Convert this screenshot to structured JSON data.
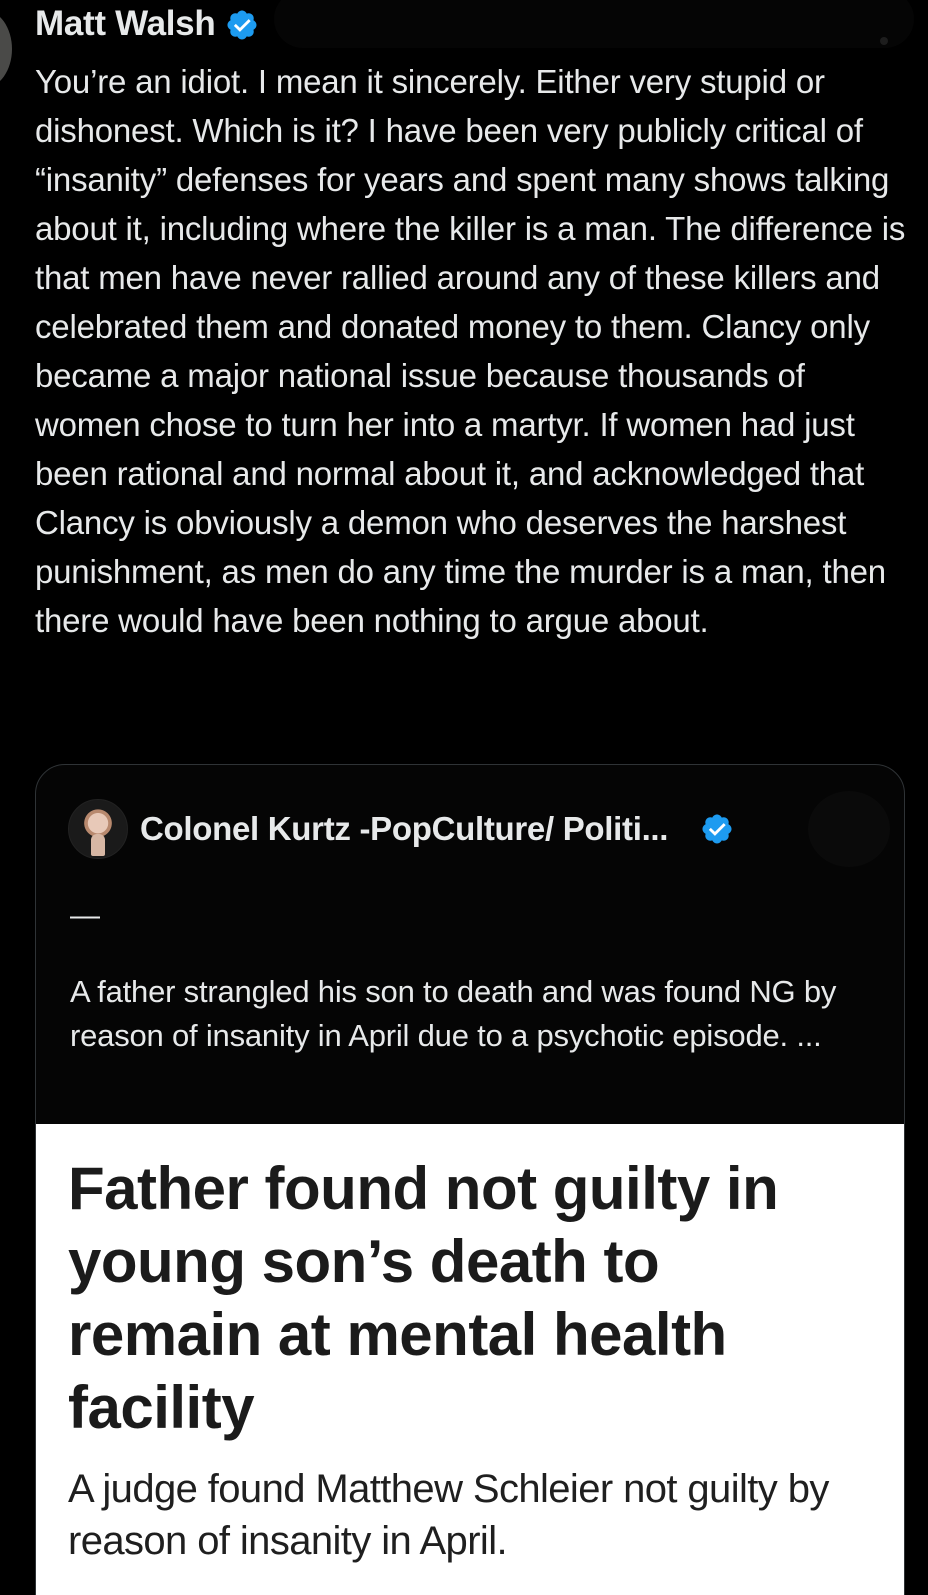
{
  "tweet": {
    "author_name": "Matt Walsh",
    "text": "You’re an idiot. I mean it sincerely. Either very stupid or dishonest. Which is it? I have been very publicly critical of “insanity” defenses for years and spent many shows talking about it, including where the killer is a man. The difference is that men have never rallied around any of these killers and celebrated them and donated money to them. Clancy only became a major national issue because thousands of women chose to turn her into a martyr. If women had just been rational and normal about it, and acknowledged that Clancy is obviously a demon who deserves the harshest punishment, as men do any time the murder is a man, then there would have been nothing to argue about."
  },
  "quote": {
    "author_name": "Colonel Kurtz -PopCulture/ Politi...",
    "dash": "—",
    "text": "A father strangled his son to death and was found NG by reason of insanity in April due to a psychotic episode. ...",
    "article": {
      "headline": "Father found not guilty in young son’s death to remain at mental health facility",
      "subhead": "A judge found Matthew Schleier not guilty by reason of insanity in April."
    }
  },
  "icons": {
    "verified": "verified-badge-icon",
    "more": "more-options-icon"
  },
  "colors": {
    "background": "#000000",
    "text": "#e7e9ea",
    "verified_blue": "#1d9bf0",
    "card_border": "#2f3336",
    "article_bg": "#ffffff",
    "article_text": "#1b1b1b"
  }
}
